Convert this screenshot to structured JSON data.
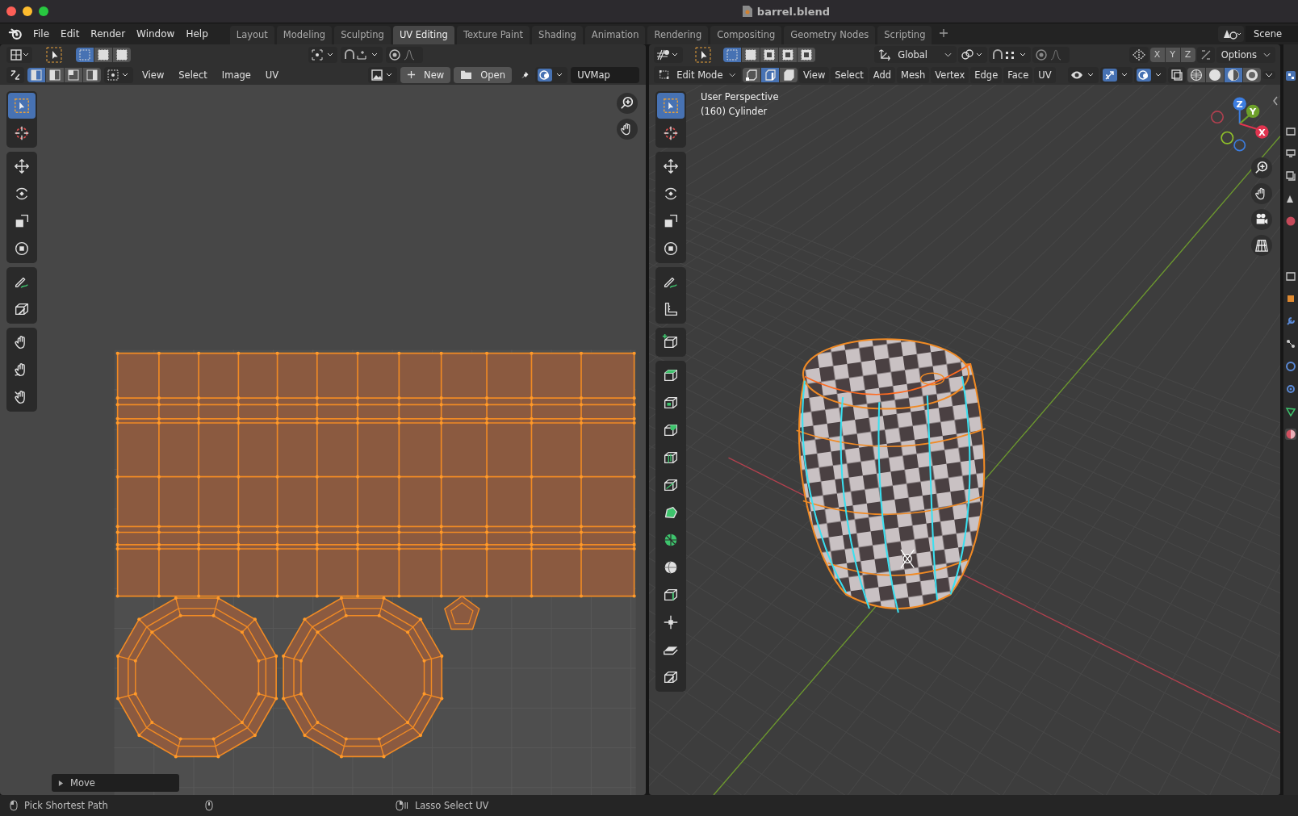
{
  "window": {
    "title": "barrel.blend"
  },
  "menu": [
    "File",
    "Edit",
    "Render",
    "Window",
    "Help"
  ],
  "workspace_tabs": [
    {
      "label": "Layout",
      "selected": false
    },
    {
      "label": "Modeling",
      "selected": false
    },
    {
      "label": "Sculpting",
      "selected": false
    },
    {
      "label": "UV Editing",
      "selected": true
    },
    {
      "label": "Texture Paint",
      "selected": false
    },
    {
      "label": "Shading",
      "selected": false
    },
    {
      "label": "Animation",
      "selected": false
    },
    {
      "label": "Rendering",
      "selected": false
    },
    {
      "label": "Compositing",
      "selected": false
    },
    {
      "label": "Geometry Nodes",
      "selected": false
    },
    {
      "label": "Scripting",
      "selected": false
    }
  ],
  "scene": "Scene",
  "uv_editor": {
    "select_modes": [
      {
        "selected": true
      },
      {
        "selected": false
      },
      {
        "selected": false
      }
    ],
    "uv_select_modes": [
      {
        "selected": true
      },
      {
        "selected": false
      },
      {
        "selected": false
      },
      {
        "selected": false
      }
    ],
    "menus": [
      "View",
      "Select",
      "Image",
      "UV"
    ],
    "new_button": "New",
    "open_button": "Open",
    "uv_map": "UVMap",
    "tool_groups": [
      [
        {
          "kind": "select",
          "selected": true
        },
        {
          "kind": "cursor",
          "selected": false
        }
      ],
      [
        {
          "kind": "move",
          "selected": false
        },
        {
          "kind": "rotate",
          "selected": false
        },
        {
          "kind": "scale",
          "selected": false
        },
        {
          "kind": "transform",
          "selected": false
        }
      ],
      [
        {
          "kind": "annotate",
          "selected": false
        },
        {
          "kind": "rip",
          "selected": false
        }
      ],
      [
        {
          "kind": "grab",
          "selected": false
        },
        {
          "kind": "relax",
          "selected": false
        },
        {
          "kind": "pinch",
          "selected": false
        }
      ]
    ],
    "last_operator": "Move"
  },
  "viewport": {
    "select_modes": [
      {
        "selected": true
      },
      {
        "selected": false
      },
      {
        "selected": false
      },
      {
        "selected": false
      },
      {
        "selected": false
      }
    ],
    "orientation": "Global",
    "axis_locks": [
      "X",
      "Y",
      "Z"
    ],
    "options": "Options",
    "mode": "Edit Mode",
    "mesh_select_modes": [
      {
        "selected": false
      },
      {
        "selected": true
      },
      {
        "selected": false
      }
    ],
    "menus": [
      "View",
      "Select",
      "Add",
      "Mesh",
      "Vertex",
      "Edge",
      "Face",
      "UV"
    ],
    "shading_modes": [
      {
        "selected": false
      },
      {
        "selected": false
      },
      {
        "selected": true
      },
      {
        "selected": false
      }
    ],
    "overlay_lines": [
      "User Perspective",
      "(160) Cylinder"
    ],
    "gizmo": [
      "X",
      "Y",
      "Z"
    ],
    "tool_groups": [
      [
        {
          "kind": "select",
          "selected": true
        },
        {
          "kind": "cursor",
          "selected": false
        }
      ],
      [
        {
          "kind": "move",
          "selected": false
        },
        {
          "kind": "rotate",
          "selected": false
        },
        {
          "kind": "scale",
          "selected": false
        },
        {
          "kind": "transform",
          "selected": false
        }
      ],
      [
        {
          "kind": "annotate",
          "selected": false
        },
        {
          "kind": "measure",
          "selected": false
        }
      ],
      [
        {
          "kind": "add-cube",
          "selected": false
        }
      ],
      [
        {
          "kind": "extrude",
          "selected": false
        },
        {
          "kind": "inset",
          "selected": false
        },
        {
          "kind": "bevel",
          "selected": false
        },
        {
          "kind": "loopcut",
          "selected": false
        },
        {
          "kind": "knife",
          "selected": false
        },
        {
          "kind": "polybuild",
          "selected": false
        },
        {
          "kind": "spin",
          "selected": false
        },
        {
          "kind": "smooth",
          "selected": false
        },
        {
          "kind": "edge-slide",
          "selected": false
        },
        {
          "kind": "shrink",
          "selected": false
        },
        {
          "kind": "shear",
          "selected": false
        },
        {
          "kind": "rip",
          "selected": false
        }
      ]
    ]
  },
  "status_bar": [
    "Pick Shortest Path",
    "Lasso Select UV"
  ]
}
